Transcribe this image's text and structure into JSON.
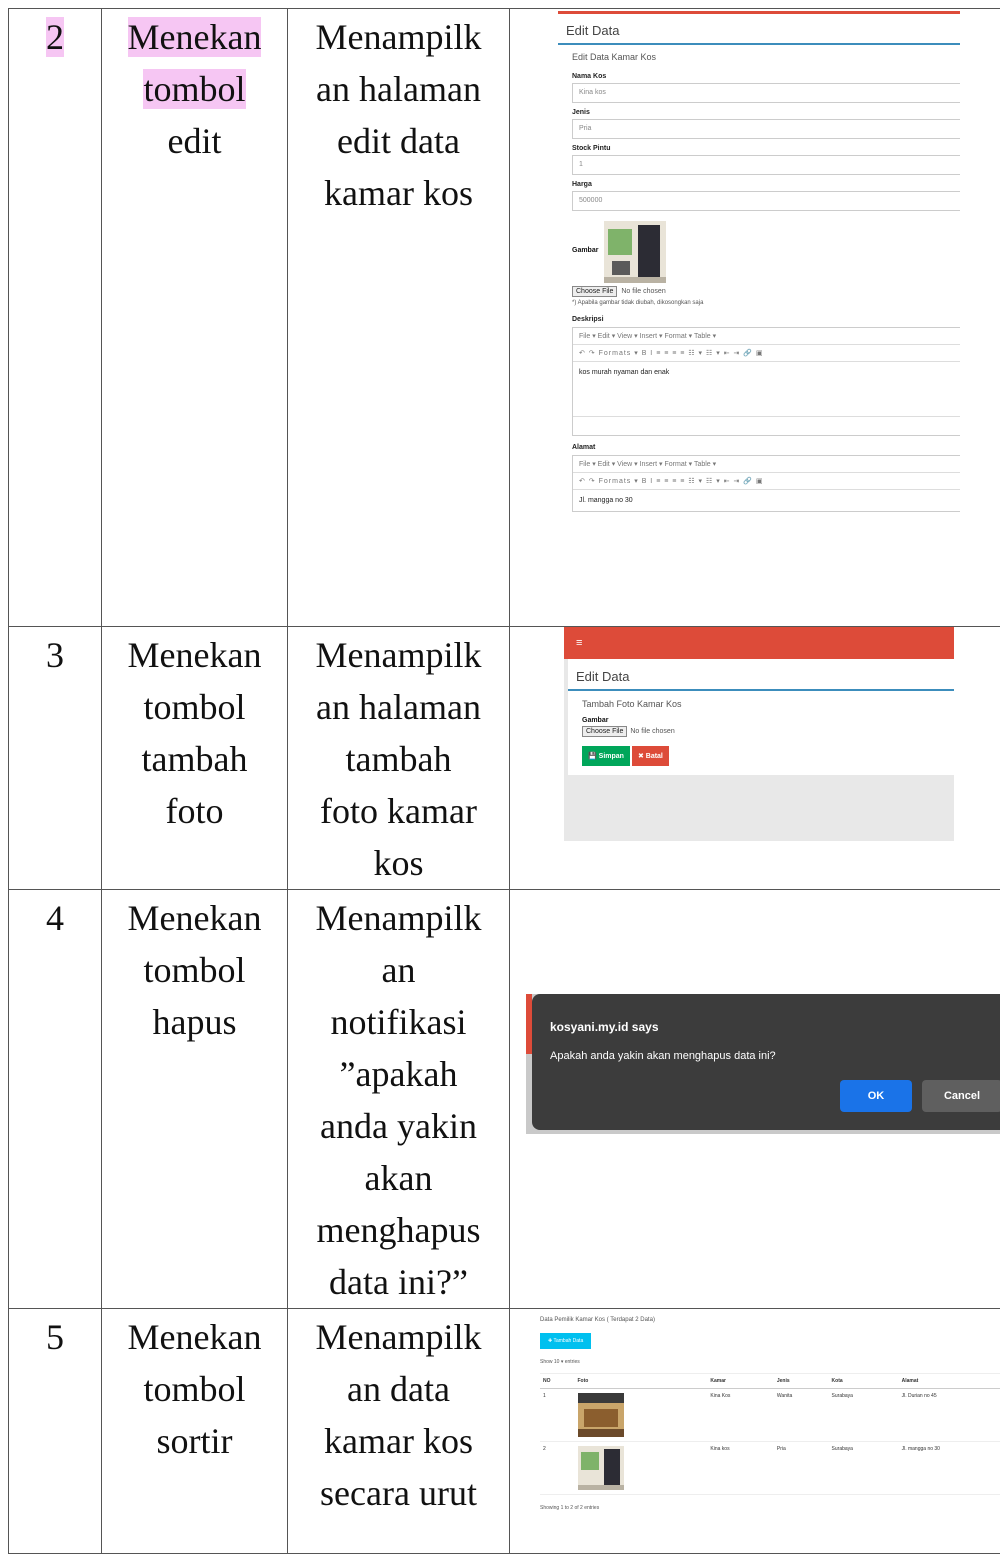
{
  "rows": [
    {
      "no": "2",
      "action_lines": [
        "Menekan",
        "tombol",
        "edit"
      ],
      "result_lines": [
        "Menampilk",
        "an halaman",
        "edit data",
        "kamar kos"
      ],
      "screenshot": {
        "header": "Edit Data",
        "subtitle": "Edit Data Kamar Kos",
        "fields": [
          {
            "label": "Nama Kos",
            "value": "Kina kos"
          },
          {
            "label": "Jenis",
            "value": "Pria"
          },
          {
            "label": "Stock Pintu",
            "value": "1"
          },
          {
            "label": "Harga",
            "value": "500000"
          }
        ],
        "image_label": "Gambar",
        "choose_file": "Choose File",
        "no_file": "No file chosen",
        "note": "*) Apabila gambar tidak diubah, dikosongkan saja",
        "desc_label": "Deskripsi",
        "editor_menu": "File ▾   Edit ▾   View ▾   Insert ▾   Format ▾   Table ▾",
        "editor_tools": "↶  ↷  Formats ▾   B  I   ≡  ≡  ≡  ≡   ☷ ▾  ☷ ▾  ⇤  ⇥  🔗  ▣",
        "desc_value": "kos murah nyaman dan enak",
        "addr_label": "Alamat",
        "addr_value": "Jl. mangga no 30"
      }
    },
    {
      "no": "3",
      "action_lines": [
        "Menekan",
        "tombol",
        "tambah",
        "foto"
      ],
      "result_lines": [
        "Menampilk",
        "an halaman",
        "tambah",
        "foto kamar",
        "kos"
      ],
      "screenshot": {
        "menu_icon": "≡",
        "header": "Edit Data",
        "subtitle": "Tambah Foto Kamar Kos",
        "image_label": "Gambar",
        "choose_file": "Choose File",
        "no_file": "No file chosen",
        "save": "💾 Simpan",
        "cancel": "✖ Batal"
      }
    },
    {
      "no": "4",
      "action_lines": [
        "Menekan",
        "tombol",
        "hapus"
      ],
      "result_lines": [
        "Menampilk",
        "an",
        "notifikasi",
        "”apakah",
        "anda yakin",
        "akan",
        "menghapus",
        "data ini?”"
      ],
      "screenshot": {
        "title": "kosyani.my.id says",
        "message": "Apakah anda yakin akan menghapus data ini?",
        "ok": "OK",
        "cancel": "Cancel"
      }
    },
    {
      "no": "5",
      "action_lines": [
        "Menekan",
        "tombol",
        "sortir"
      ],
      "result_lines": [
        "Menampilk",
        "an data",
        "kamar kos",
        "secara urut"
      ],
      "screenshot": {
        "title": "Data Pemilik Kamar Kos ( Terdapat 2 Data)",
        "add_button": "✚ Tambah Data",
        "show_entries": "Show  10  ▾  entries",
        "columns": [
          "NO",
          "Foto",
          "Kamar",
          "Jenis",
          "Kota",
          "Alamat"
        ],
        "rows": [
          [
            "1",
            "",
            "Kina Kos",
            "Wanita",
            "Surabaya",
            "Jl. Durian no 45"
          ],
          [
            "2",
            "",
            "Kina kos",
            "Pria",
            "Surabaya",
            "Jl. mangga no 30"
          ]
        ],
        "footer": "Showing 1 to 2 of 2 entries"
      }
    }
  ]
}
